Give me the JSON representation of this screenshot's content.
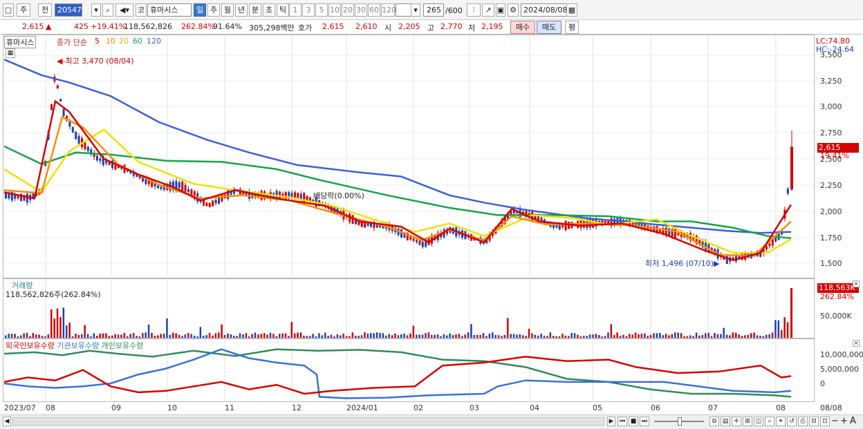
{
  "toolbar": {
    "mode_label": "주",
    "prev_label": "전",
    "code": "205470",
    "market_label": "코",
    "stock_name": "휴마시스",
    "periods": [
      "일",
      "주",
      "월",
      "년",
      "분",
      "초",
      "틱"
    ],
    "active_period": "일",
    "intervals": [
      "1",
      "3",
      "5",
      "10",
      "20",
      "30",
      "60",
      "120"
    ],
    "count": "265",
    "count_total": "/600",
    "date": "2024/08/08"
  },
  "quote": {
    "price": "2,615",
    "arrow": "▲",
    "change": "425",
    "change_pct": "+19.41%",
    "volume": "118,562,826",
    "volume_ratio": "262.84%",
    "turnover": "91.64%",
    "amount": "305,298백만",
    "bid_ask_label": "호가",
    "ask": "2,615",
    "bid": "2,610",
    "open_label": "시",
    "open": "2,205",
    "high_label": "고",
    "high": "2,770",
    "low_label": "저",
    "low": "2,195",
    "buy_label": "매수",
    "sell_label": "매도",
    "eval_label": "평"
  },
  "price_panel": {
    "stock_tag": "휴마시스",
    "ma_title": "종가 단순",
    "ma_periods": [
      "5",
      "10",
      "20",
      "60",
      "120"
    ],
    "lc_label": "LC:74.80",
    "hc_label": "HC:-24.64",
    "high_note": "최고 3,470 (08/04)",
    "low_note": "최저 1,496 (07/10)",
    "dividend_note": "배당락(0.00%)",
    "last_price_tag": "2,615",
    "last_pct_tag": "19.41%",
    "y_ticks": [
      "3,500",
      "3,250",
      "3,000",
      "2,750",
      "2,500",
      "2,250",
      "2,000",
      "1,750",
      "1,500"
    ]
  },
  "volume_panel": {
    "title": "거래량",
    "value_text": "118,562,826주(262.84%)",
    "last_tag": "118,563K",
    "last_pct": "262.84%",
    "y_tick": "50,000K"
  },
  "holdings_panel": {
    "legend": [
      "외국인보유수량",
      "기관보유수량",
      "개인보유수량"
    ],
    "y_ticks": [
      "10,000,000",
      "5,000,000",
      "0"
    ]
  },
  "x_axis": {
    "labels": [
      "2023/07",
      "08",
      "09",
      "10",
      "11",
      "12",
      "2024/01",
      "02",
      "03",
      "04",
      "05",
      "06",
      "07",
      "08",
      "08/08"
    ]
  },
  "colors": {
    "up": "#d40000",
    "down": "#1e3fb3",
    "ma5": "#d40000",
    "ma10": "#ff8c00",
    "ma20": "#f0e000",
    "ma60": "#16a34a",
    "ma120": "#3b5fd8",
    "foreign": "#d40000",
    "institution": "#3b6fd8",
    "individual": "#2e8b57"
  }
}
